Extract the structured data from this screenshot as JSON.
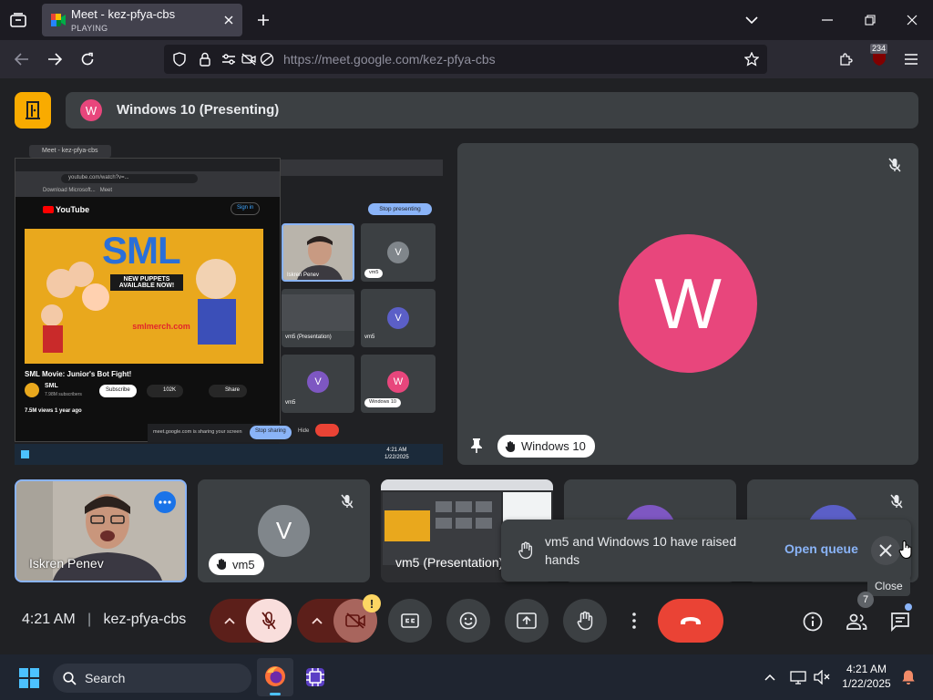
{
  "browser": {
    "tab_title": "Meet - kez-pfya-cbs",
    "tab_status": "PLAYING",
    "url_host": "https://meet.google.com",
    "url_path": "/kez-pfya-cbs",
    "extensions_badge": "234"
  },
  "meet": {
    "presenting_avatar_letter": "W",
    "presenting_label": "Windows 10 (Presenting)",
    "main_tile": {
      "avatar_letter": "W",
      "name": "Windows 10",
      "avatar_color": "#e8467c"
    },
    "shared_screen": {
      "inner_tab_1": "Meet - kez-pfya-cbs",
      "youtube_url": "youtube.com/watch?v=...",
      "bookmark_1": "Download Microsoft...",
      "bookmark_2": "Meet",
      "yt_logo": "YouTube",
      "sign_in": "Sign in",
      "sml_title": "SML",
      "new_puppets": "NEW PUPPETS AVAILABLE NOW!",
      "merch": "smlmerch.com",
      "video_title": "SML Movie: Junior's Bot Fight!",
      "channel": "SML",
      "subs": "7.98M subscribers",
      "subscribe": "Subscribe",
      "likes": "102K",
      "share": "Share",
      "views": "7.5M views  1 year ago",
      "stop_presenting": "Stop presenting",
      "sharing_msg": "meet.google.com is sharing your screen",
      "stop_sharing": "Stop sharing",
      "hide": "Hide",
      "mini_tiles": [
        {
          "name": "Iskren Penev"
        },
        {
          "name": "vm5",
          "letter": "V"
        },
        {
          "name": "vm5 (Presentation)"
        },
        {
          "name": "vm5",
          "letter": "V"
        },
        {
          "name": "vm5",
          "letter": "V"
        },
        {
          "name": "Windows 10",
          "letter": "W"
        }
      ],
      "clock_time": "4:21 AM",
      "clock_date": "1/22/2025"
    },
    "filmstrip": [
      {
        "name": "Iskren Penev"
      },
      {
        "name": "vm5",
        "letter": "V",
        "color": "#80868b"
      },
      {
        "name": "vm5 (Presentation)"
      }
    ],
    "toast": {
      "message": "vm5 and Windows 10 have raised hands",
      "action": "Open queue",
      "close_tooltip": "Close"
    },
    "footer": {
      "time": "4:21 AM",
      "divider": "|",
      "meeting_code": "kez-pfya-cbs",
      "people_count": "7",
      "warning_badge": "!"
    }
  },
  "taskbar": {
    "search_placeholder": "Search",
    "time": "4:21 AM",
    "date": "1/22/2025"
  },
  "colors": {
    "brand_yellow": "#f9ab00",
    "end_call_red": "#ea4335",
    "muted_red": "#f9dedc",
    "accent_blue": "#8ab4f8"
  }
}
